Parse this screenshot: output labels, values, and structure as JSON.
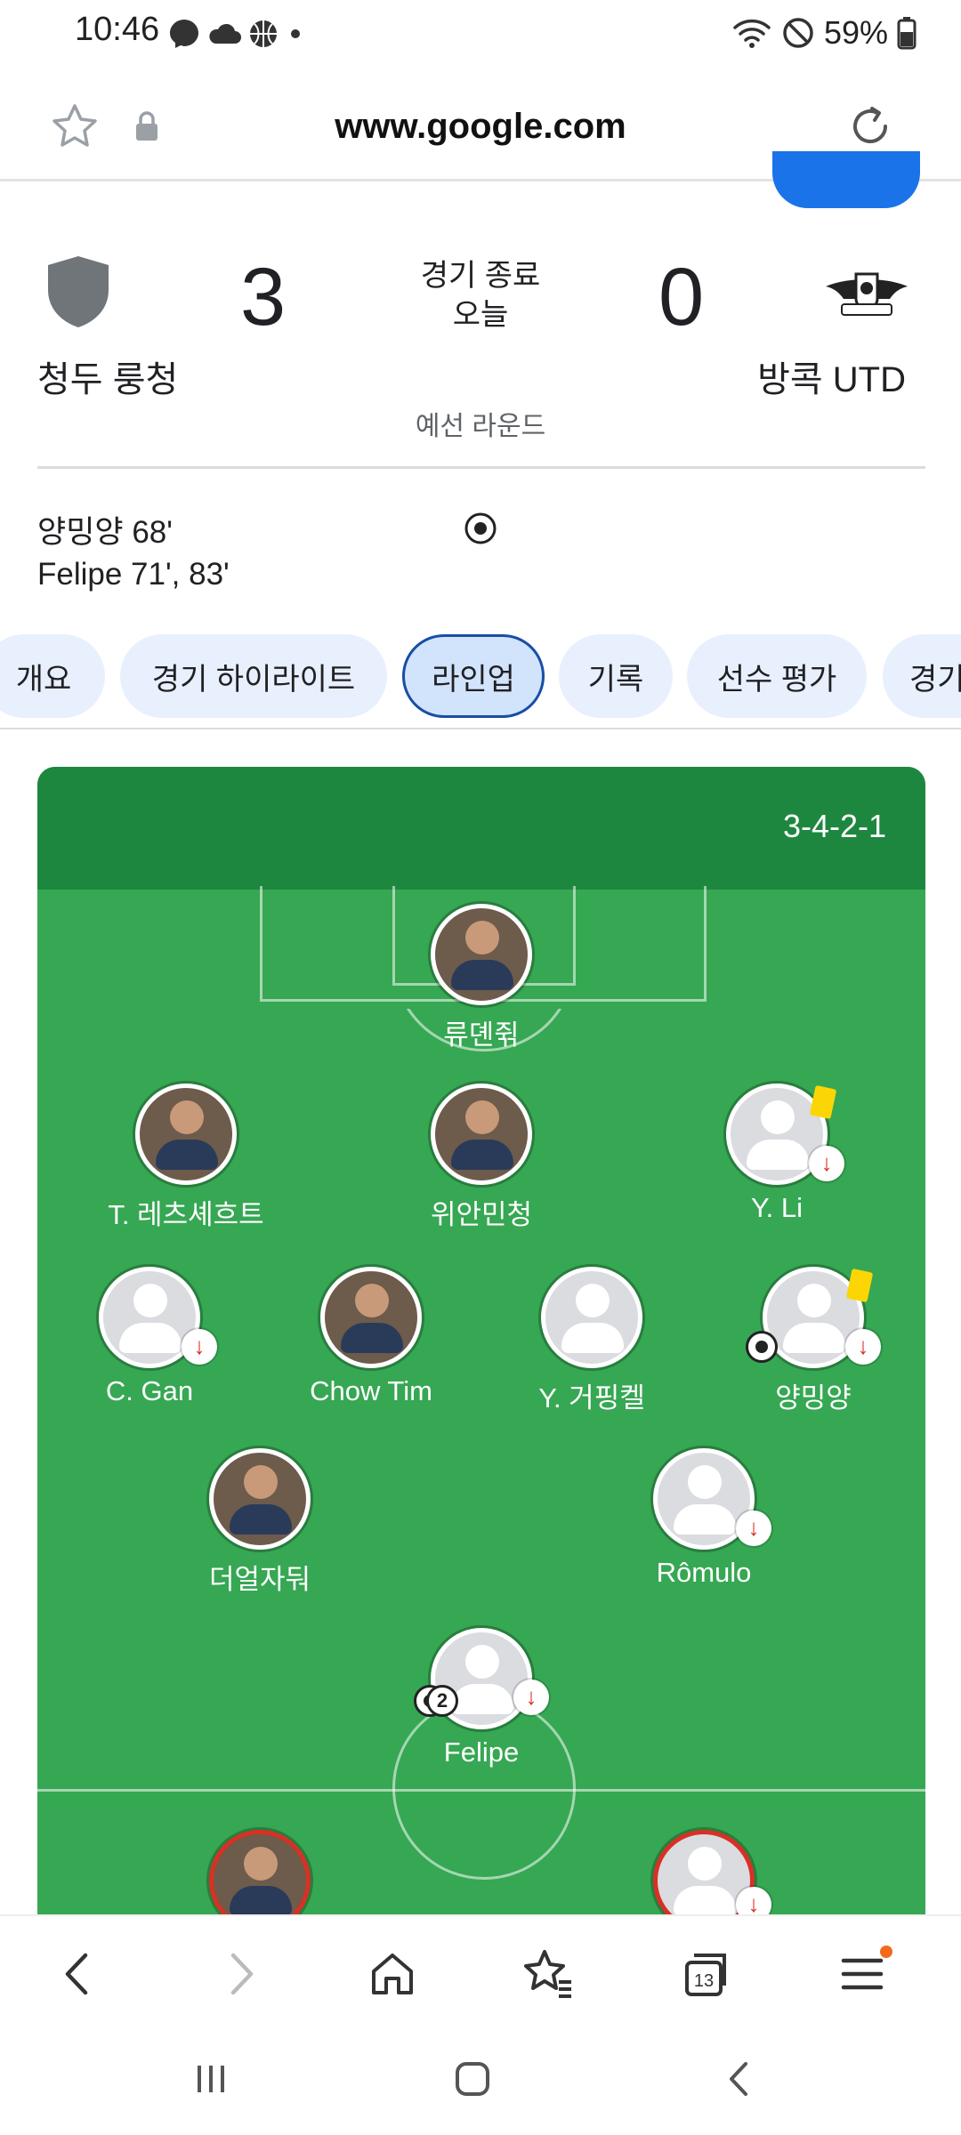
{
  "status_bar": {
    "time": "10:46",
    "battery_percent": "59%",
    "icons": [
      "messenger-icon",
      "cloud-icon",
      "basketball-icon",
      "dot-icon",
      "wifi-icon",
      "do-not-disturb-icon",
      "battery-icon"
    ]
  },
  "browser": {
    "url": "www.google.com",
    "icons": [
      "star-icon",
      "lock-icon",
      "reload-icon"
    ]
  },
  "match": {
    "home_team": "청두 룽청",
    "away_team": "방콕 UTD",
    "home_score": "3",
    "away_score": "0",
    "status": "경기 종료",
    "date": "오늘",
    "round": "예선 라운드",
    "scorers": [
      "양밍양 68'",
      "Felipe 71', 83'"
    ],
    "away_logo_text": "BANGKOK UNITED"
  },
  "tabs": [
    {
      "label": "개요",
      "active": false
    },
    {
      "label": "경기 하이라이트",
      "active": false
    },
    {
      "label": "라인업",
      "active": true
    },
    {
      "label": "기록",
      "active": false
    },
    {
      "label": "선수 평가",
      "active": false
    },
    {
      "label": "경기",
      "active": false
    }
  ],
  "lineup": {
    "formation": "3-4-2-1",
    "players": [
      {
        "name": "류뎬쥒",
        "photo": true
      },
      {
        "name": "T. 레츠셰흐트",
        "photo": true
      },
      {
        "name": "위안민청",
        "photo": true
      },
      {
        "name": "Y. Li",
        "photo": false,
        "yellow_card": true,
        "substituted": true
      },
      {
        "name": "C. Gan",
        "photo": false,
        "substituted": true
      },
      {
        "name": "Chow Tim",
        "photo": true
      },
      {
        "name": "Y. 거핑켈",
        "photo": false
      },
      {
        "name": "양밍양",
        "photo": false,
        "yellow_card": true,
        "substituted": true,
        "goals": 1
      },
      {
        "name": "더얼자둬",
        "photo": true
      },
      {
        "name": "Rômulo",
        "photo": false,
        "substituted": true
      },
      {
        "name": "Felipe",
        "photo": false,
        "substituted": true,
        "goals": 2,
        "goal_badge": "2"
      }
    ]
  },
  "colors": {
    "pitch": "#36a753",
    "pitch_header": "#1e873f",
    "tab_bg": "#e8f0fe",
    "tab_active_border": "#174ea6",
    "blue_button": "#1a73e8",
    "yellow_card": "#fbd604",
    "sub_arrow": "#d93025"
  }
}
